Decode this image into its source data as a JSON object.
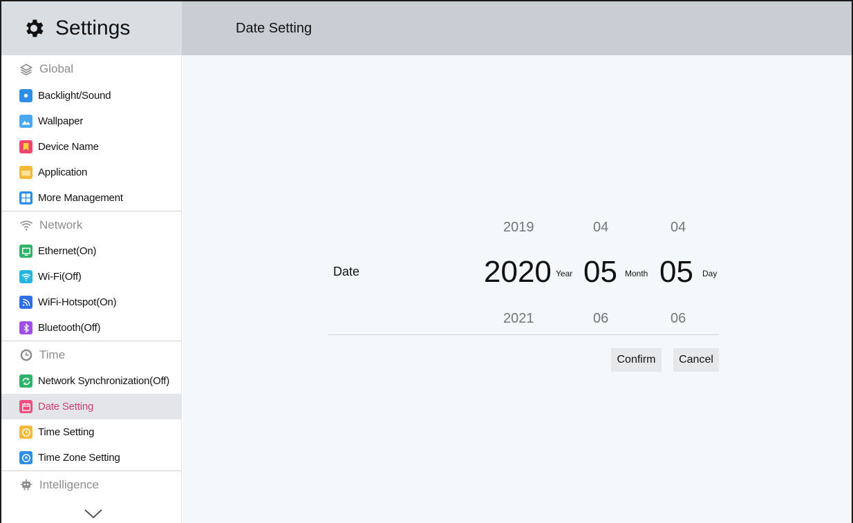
{
  "app": {
    "title": "Settings"
  },
  "header": {
    "page_title": "Date Setting"
  },
  "sidebar": {
    "sections": [
      {
        "label": "Global",
        "icon": "layers-icon",
        "items": [
          {
            "label": "Backlight/Sound",
            "icon": "backlight-icon",
            "color": "#2d8ee6"
          },
          {
            "label": "Wallpaper",
            "icon": "wallpaper-icon",
            "color": "#4aa8f0"
          },
          {
            "label": "Device Name",
            "icon": "bookmark-icon",
            "color": "#f0436e"
          },
          {
            "label": "Application",
            "icon": "folder-icon",
            "color": "#f4b83a"
          },
          {
            "label": "More Management",
            "icon": "grid-icon",
            "color": "#2d8ee6"
          }
        ]
      },
      {
        "label": "Network",
        "icon": "wifi-icon",
        "items": [
          {
            "label": "Ethernet(On)",
            "icon": "monitor-icon",
            "color": "#2fb36b"
          },
          {
            "label": "Wi-Fi(Off)",
            "icon": "wifi-icon",
            "color": "#25b5e0"
          },
          {
            "label": "WiFi-Hotspot(On)",
            "icon": "hotspot-icon",
            "color": "#2d6ee6"
          },
          {
            "label": "Bluetooth(Off)",
            "icon": "bluetooth-icon",
            "color": "#a14de6"
          }
        ]
      },
      {
        "label": "Time",
        "icon": "clock-icon",
        "items": [
          {
            "label": "Network Synchronization(Off)",
            "icon": "sync-icon",
            "color": "#2fb36b"
          },
          {
            "label": "Date Setting",
            "icon": "calendar-icon",
            "color": "#ec4d7c",
            "active": true
          },
          {
            "label": "Time Setting",
            "icon": "clock-icon",
            "color": "#f4b83a"
          },
          {
            "label": "Time Zone Setting",
            "icon": "timezone-icon",
            "color": "#2d8ee6"
          }
        ]
      },
      {
        "label": "Intelligence",
        "icon": "robot-icon",
        "items": []
      }
    ]
  },
  "date_picker": {
    "label": "Date",
    "year": {
      "prev": "2019",
      "selected": "2020",
      "next": "2021",
      "unit": "Year"
    },
    "month": {
      "prev": "04",
      "selected": "05",
      "next": "06",
      "unit": "Month"
    },
    "day": {
      "prev": "04",
      "selected": "05",
      "next": "06",
      "unit": "Day"
    },
    "confirm_label": "Confirm",
    "cancel_label": "Cancel"
  },
  "colors": {
    "active_text": "#cf3f6e",
    "header_left_bg": "#d9dee2",
    "header_right_bg": "#c9ced4",
    "content_bg": "#f4f8fb"
  }
}
